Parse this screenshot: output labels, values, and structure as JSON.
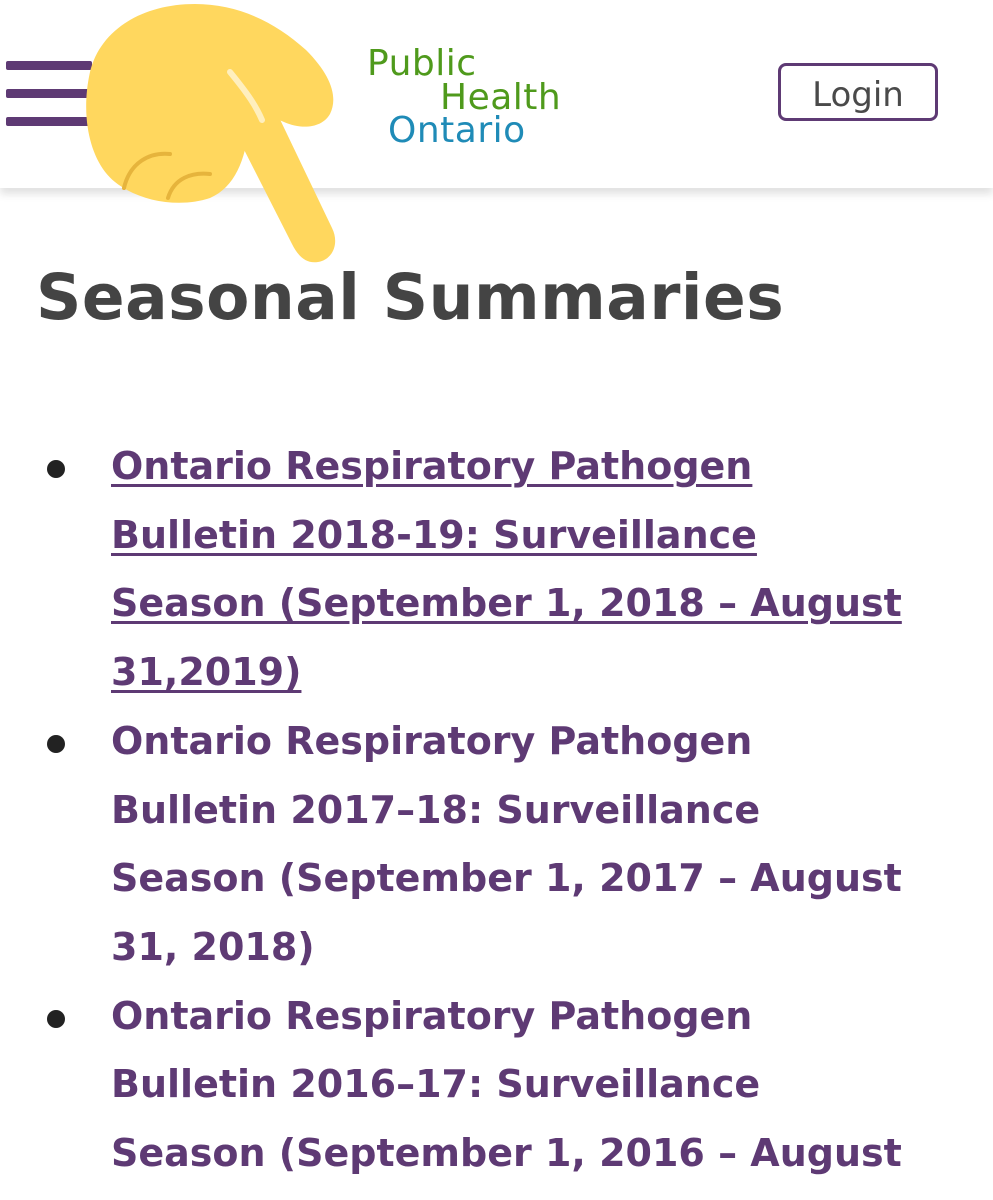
{
  "header": {
    "menu_icon": "hamburger-menu-icon",
    "logo": {
      "line1": "Public",
      "line2": "Health",
      "line3": "Ontario"
    },
    "login_label": "Login"
  },
  "page_title": "Seasonal Summaries",
  "bulletins": [
    {
      "lines": [
        "Ontario Respiratory Pathogen",
        "Bulletin 2018-19: Surveillance",
        "Season (September 1, 2018 – August",
        "31,2019)"
      ],
      "underlined": true
    },
    {
      "lines": [
        "Ontario Respiratory Pathogen",
        "Bulletin 2017–18: Surveillance",
        "Season (September 1, 2017 – August",
        "31, 2018)"
      ],
      "underlined": false
    },
    {
      "lines": [
        "Ontario Respiratory Pathogen",
        "Bulletin 2016–17: Surveillance",
        "Season (September 1, 2016 – August"
      ],
      "underlined": false
    }
  ],
  "overlay": {
    "icon": "pointing-hand-emoji-icon"
  },
  "colors": {
    "brand_purple": "#5e3a74",
    "link_purple": "#5e3a74",
    "logo_green": "#4f9a1c",
    "logo_blue": "#1f8bb7",
    "title_gray": "#444444",
    "hand_yellow": "#ffd75e"
  }
}
